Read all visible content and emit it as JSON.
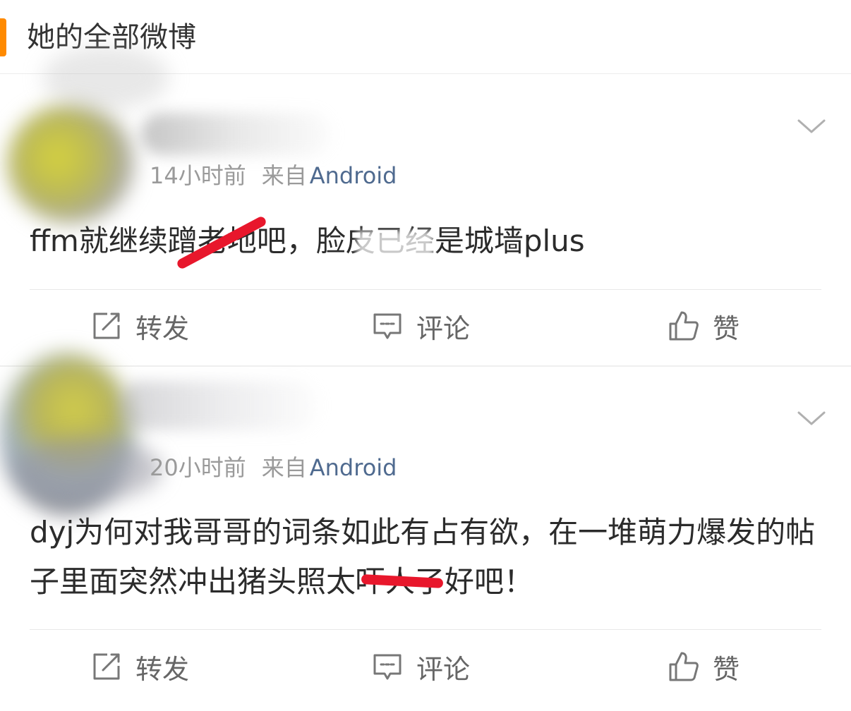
{
  "header": {
    "title": "她的全部微博"
  },
  "posts": [
    {
      "time": "14小时前",
      "source_label": "来自",
      "source_name": "Android",
      "text": "ffm就继续蹭老地吧，脸皮已经是城墙plus"
    },
    {
      "time": "20小时前",
      "source_label": "来自",
      "source_name": "Android",
      "text": "dyj为何对我哥哥的词条如此有占有欲，在一堆萌力爆发的帖子里面突然冲出猪头照太吓人了好吧！"
    }
  ],
  "actions": {
    "repost": "转发",
    "comment": "评论",
    "like": "赞"
  },
  "icons": {
    "repost": "repost-icon",
    "comment": "comment-icon",
    "like": "thumbs-up-icon",
    "menu": "chevron-down-icon"
  },
  "colors": {
    "accent": "#ff8a00",
    "source_link": "#4f6a8f",
    "redaction": "#e8172c"
  }
}
